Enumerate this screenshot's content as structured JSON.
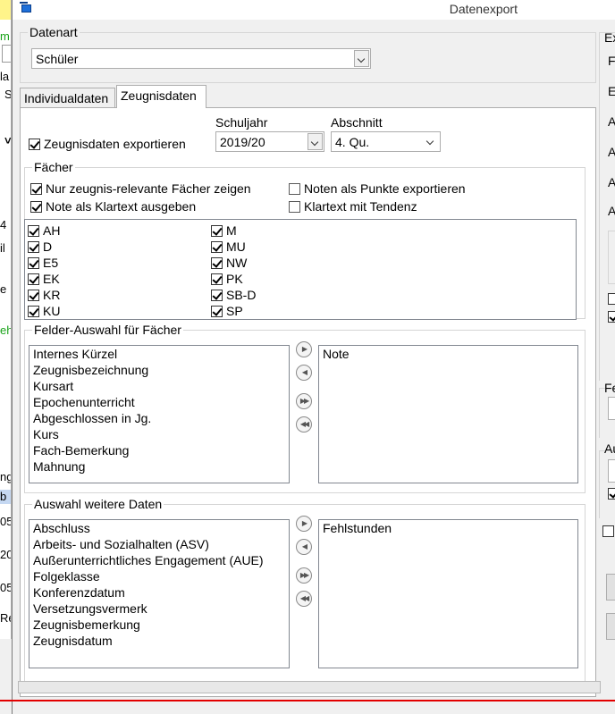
{
  "window": {
    "title": "Datenexport"
  },
  "background_window": {
    "fragments": [
      "m",
      "la",
      "S",
      "4",
      "il",
      "e",
      "eh",
      "ng",
      "b",
      "05",
      "20",
      "05",
      "Re"
    ],
    "fragment_colors": {
      "green": "#19a319",
      "yellow": "#fff48a",
      "blue": "#c5d8f2"
    }
  },
  "datenart": {
    "label": "Datenart",
    "selected": "Schüler"
  },
  "tabs": [
    {
      "label": "Individualdaten",
      "active": false
    },
    {
      "label": "Zeugnisdaten",
      "active": true
    }
  ],
  "zeugnisdaten": {
    "export_checkbox": {
      "label": "Zeugnisdaten exportieren",
      "checked": true
    },
    "schuljahr": {
      "label": "Schuljahr",
      "selected": "2019/20"
    },
    "abschnitt": {
      "label": "Abschnitt",
      "selected": "4. Qu."
    }
  },
  "faecher": {
    "label": "Fächer",
    "options": [
      {
        "label": "Nur zeugnis-relevante Fächer zeigen",
        "checked": true
      },
      {
        "label": "Noten als Punkte exportieren",
        "checked": false
      },
      {
        "label": "Note als Klartext ausgeben",
        "checked": true
      },
      {
        "label": "Klartext mit Tendenz",
        "checked": false
      }
    ],
    "subjects_col1": [
      {
        "label": "AH",
        "checked": true
      },
      {
        "label": "D",
        "checked": true
      },
      {
        "label": "E5",
        "checked": true
      },
      {
        "label": "EK",
        "checked": true
      },
      {
        "label": "KR",
        "checked": true
      },
      {
        "label": "KU",
        "checked": true
      }
    ],
    "subjects_col2": [
      {
        "label": "M",
        "checked": true
      },
      {
        "label": "MU",
        "checked": true
      },
      {
        "label": "NW",
        "checked": true
      },
      {
        "label": "PK",
        "checked": true
      },
      {
        "label": "SB-D",
        "checked": true
      },
      {
        "label": "SP",
        "checked": true
      }
    ]
  },
  "felder_auswahl": {
    "label": "Felder-Auswahl für Fächer",
    "available": [
      "Internes Kürzel",
      "Zeugnisbezeichnung",
      "Kursart",
      "Epochenunterricht",
      "Abgeschlossen in Jg.",
      "Kurs",
      "Fach-Bemerkung",
      "Mahnung"
    ],
    "selected": [
      "Note"
    ]
  },
  "weitere_daten": {
    "label": "Auswahl weitere Daten",
    "available": [
      "Abschluss",
      "Arbeits- und Sozialhalten (ASV)",
      "Außerunterrichtliches Engagement (AUE)",
      "Folgeklasse",
      "Konferenzdatum",
      "Versetzungsvermerk",
      "Zeugnisbemerkung",
      "Zeugnisdatum"
    ],
    "selected": [
      "Fehlstunden"
    ]
  },
  "right_panel": {
    "group1_label": "Ex",
    "letters": [
      "F",
      "E",
      "A",
      "A",
      "A",
      "A"
    ],
    "group2_label": "Fe",
    "group3_label": "Au"
  },
  "colors": {
    "accent_red": "#e30000",
    "icon_blue": "#1e6fd9"
  }
}
